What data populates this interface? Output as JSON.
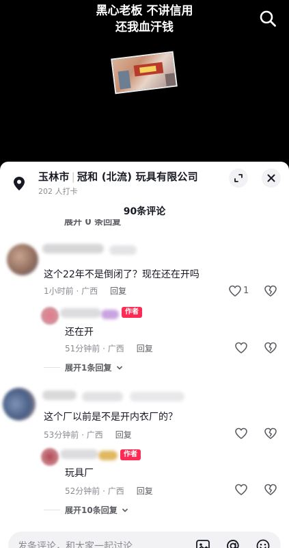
{
  "video": {
    "caption_line1": "黑心老板 不讲信用",
    "caption_line2": "还我血汗钱",
    "search_icon": "search-icon"
  },
  "location": {
    "city": "玉林市",
    "name": "冠和 (北流) 玩具有限公司",
    "checkins": "202 人打卡"
  },
  "comments_header": "90条评论",
  "cutoff_text": "展开 0 条回复",
  "comments": [
    {
      "text": "这个22年不是倒闭了？现在还在开吗",
      "time_loc": "1小时前 · 广西",
      "reply": "回复",
      "likes": "1",
      "sub": {
        "badge": "作者",
        "text": "还在开",
        "time_loc": "51分钟前 · 广西",
        "reply": "回复"
      },
      "expand": "展开1条回复"
    },
    {
      "text": "这个厂以前是不是开内衣厂的？",
      "time_loc": "53分钟前 · 广西",
      "reply": "回复",
      "sub": {
        "badge": "作者",
        "text": "玩具厂",
        "time_loc": "52分钟前 · 广西",
        "reply": "回复"
      },
      "expand": "展开10条回复"
    }
  ],
  "input": {
    "placeholder": "发条评论，和大家一起讨论"
  },
  "colors": {
    "accent": "#fe2c55",
    "text": "#161823",
    "muted": "#8a8b91"
  }
}
